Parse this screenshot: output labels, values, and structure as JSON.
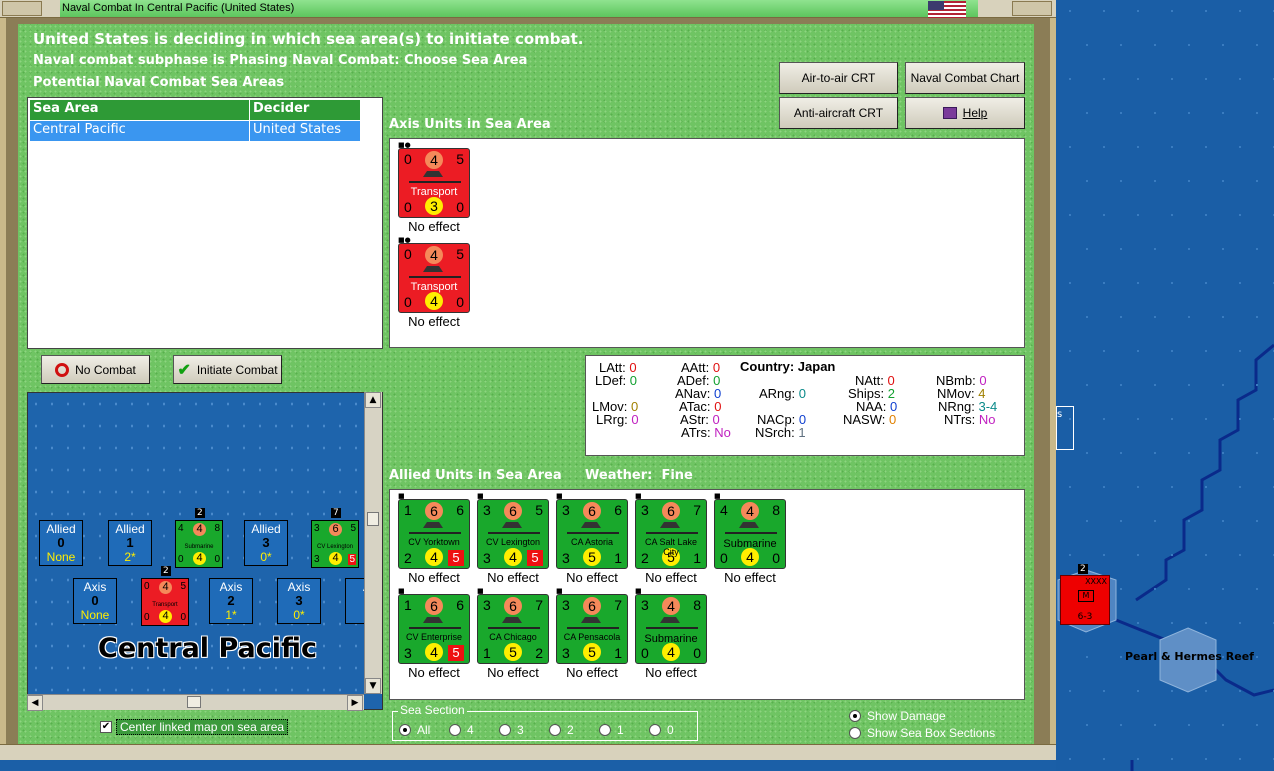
{
  "window": {
    "title": "Naval Combat In Central Pacific (United States)"
  },
  "header": {
    "headline": "United States is deciding in which sea area(s) to initiate combat.",
    "subphase": "Naval combat subphase is Phasing Naval Combat: Choose Sea Area",
    "potential_label": "Potential Naval Combat Sea Areas"
  },
  "sea_table": {
    "columns": [
      "Sea Area",
      "Decider"
    ],
    "rows": [
      [
        "Central Pacific",
        "United States"
      ]
    ]
  },
  "buttons": {
    "air_to_air": "Air-to-air CRT",
    "naval_chart": "Naval Combat Chart",
    "anti_aircraft": "Anti-aircraft CRT",
    "help": "Help",
    "no_combat": "No Combat",
    "initiate": "Initiate Combat"
  },
  "axis_units": {
    "title": "Axis Units in Sea Area",
    "units": [
      {
        "tl": "0",
        "tc": "4",
        "tr": "5",
        "name": "Transport",
        "bl": "0",
        "bc": "3",
        "br": "0",
        "effect": "No effect"
      },
      {
        "tl": "0",
        "tc": "4",
        "tr": "5",
        "name": "Transport",
        "bl": "0",
        "bc": "4",
        "br": "0",
        "effect": "No effect"
      }
    ]
  },
  "info": {
    "country_label": "Country:",
    "country": "Japan",
    "items": [
      {
        "k": "LAtt:",
        "v": "0"
      },
      {
        "k": "AAtt:",
        "v": "0"
      },
      {
        "k": "NAtt:",
        "v": "0"
      },
      {
        "k": "NBmb:",
        "v": "0"
      },
      {
        "k": "LDef:",
        "v": "0"
      },
      {
        "k": "ADef:",
        "v": "0"
      },
      {
        "k": "Ships:",
        "v": "2"
      },
      {
        "k": "NMov:",
        "v": "4"
      },
      {
        "k": "ANav:",
        "v": "0"
      },
      {
        "k": "ARng:",
        "v": "0"
      },
      {
        "k": "NAA:",
        "v": "0"
      },
      {
        "k": "NRng:",
        "v": "3-4"
      },
      {
        "k": "LMov:",
        "v": "0"
      },
      {
        "k": "ATac:",
        "v": "0"
      },
      {
        "k": "LRrg:",
        "v": "0"
      },
      {
        "k": "AStr:",
        "v": "0"
      },
      {
        "k": "NACp:",
        "v": "0"
      },
      {
        "k": "NASW:",
        "v": "0"
      },
      {
        "k": "NTrs:",
        "v": "No"
      },
      {
        "k": "ATrs:",
        "v": "No"
      },
      {
        "k": "NSrch:",
        "v": "1"
      }
    ]
  },
  "allied_units": {
    "title": "Allied Units in Sea Area",
    "weather_label": "Weather:",
    "weather": "Fine",
    "units": [
      {
        "tl": "1",
        "tc": "6",
        "tr": "6",
        "name": "CV Yorktown",
        "bl": "2",
        "bc": "4",
        "br": "5",
        "effect": "No effect"
      },
      {
        "tl": "3",
        "tc": "6",
        "tr": "5",
        "name": "CV Lexington",
        "bl": "3",
        "bc": "4",
        "br": "5",
        "effect": "No effect"
      },
      {
        "tl": "3",
        "tc": "6",
        "tr": "6",
        "name": "CA Astoria",
        "bl": "3",
        "bc": "5",
        "br": "1",
        "effect": "No effect"
      },
      {
        "tl": "3",
        "tc": "6",
        "tr": "7",
        "name": "CA Salt Lake City",
        "bl": "2",
        "bc": "5",
        "br": "1",
        "effect": "No effect"
      },
      {
        "tl": "4",
        "tc": "4",
        "tr": "8",
        "name": "Submarine",
        "bl": "0",
        "bc": "4",
        "br": "0",
        "effect": "No effect"
      },
      {
        "tl": "1",
        "tc": "6",
        "tr": "6",
        "name": "CV Enterprise",
        "bl": "3",
        "bc": "4",
        "br": "5",
        "effect": "No effect"
      },
      {
        "tl": "3",
        "tc": "6",
        "tr": "7",
        "name": "CA Chicago",
        "bl": "1",
        "bc": "5",
        "br": "2",
        "effect": "No effect"
      },
      {
        "tl": "3",
        "tc": "6",
        "tr": "7",
        "name": "CA Pensacola",
        "bl": "3",
        "bc": "5",
        "br": "1",
        "effect": "No effect"
      },
      {
        "tl": "3",
        "tc": "4",
        "tr": "8",
        "name": "Submarine",
        "bl": "0",
        "bc": "4",
        "br": "0",
        "effect": "No effect"
      }
    ]
  },
  "seabox": {
    "name": "Central Pacific",
    "allied_boxes": [
      {
        "side": "Allied",
        "num": "0",
        "sub": "None"
      },
      {
        "side": "Allied",
        "num": "1",
        "sub": "2*"
      },
      {
        "side": "Allied",
        "num": "3",
        "sub": "0*"
      }
    ],
    "axis_boxes": [
      {
        "side": "Axis",
        "num": "0",
        "sub": "None"
      },
      {
        "side": "Axis",
        "num": "2",
        "sub": "1*"
      },
      {
        "side": "Axis",
        "num": "3",
        "sub": "0*"
      },
      {
        "side": "A",
        "num": "",
        "sub": ""
      }
    ],
    "mini_counters": [
      {
        "tl": "4",
        "tc": "4",
        "tr": "8",
        "name": "Submarine",
        "bl": "0",
        "bc": "4",
        "br": "0",
        "stack": "2"
      },
      {
        "tl": "3",
        "tc": "6",
        "tr": "5",
        "name": "CV Lexington",
        "bl": "3",
        "bc": "4",
        "br": "5",
        "stack": "7"
      },
      {
        "tl": "0",
        "tc": "4",
        "tr": "5",
        "name": "Transport",
        "bl": "0",
        "bc": "4",
        "br": "0",
        "stack": "2"
      }
    ]
  },
  "options": {
    "center_linked": "Center linked map on sea area",
    "sea_section_label": "Sea Section",
    "sea_sections": [
      "All",
      "4",
      "3",
      "2",
      "1",
      "0"
    ],
    "selected_section": "All",
    "show_damage": "Show Damage",
    "show_sea_box": "Show Sea Box Sections"
  },
  "map": {
    "place": "Pearl & Hermes Reef",
    "counter_stack": "2",
    "counter_top": "XXXX",
    "counter_mid": "M",
    "counter_bot": "6-3",
    "side_label": "s"
  },
  "colors": {
    "panel_green": "#6fc463",
    "axis_red": "#ec1c24",
    "allied_green": "#19a82c",
    "header_green": "#2e9a36",
    "selection_blue": "#3a96f0",
    "sea_blue": "#1a5ea6"
  }
}
